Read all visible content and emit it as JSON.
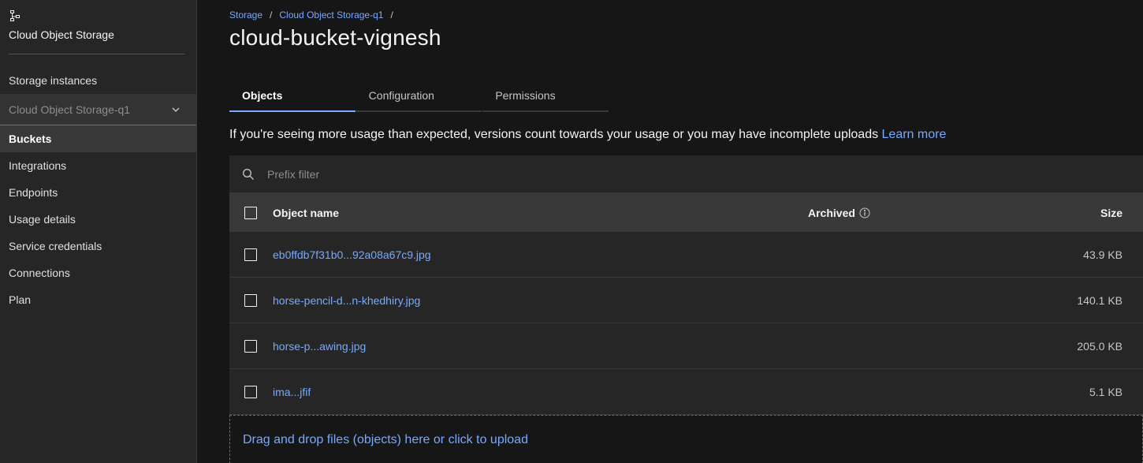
{
  "sidebar": {
    "service_title": "Cloud Object Storage",
    "items": [
      {
        "label": "Storage instances"
      },
      {
        "label": "Cloud Object Storage-q1"
      },
      {
        "label": "Buckets"
      },
      {
        "label": "Integrations"
      },
      {
        "label": "Endpoints"
      },
      {
        "label": "Usage details"
      },
      {
        "label": "Service credentials"
      },
      {
        "label": "Connections"
      },
      {
        "label": "Plan"
      }
    ]
  },
  "breadcrumb": {
    "items": [
      "Storage",
      "Cloud Object Storage-q1"
    ],
    "separator": "/"
  },
  "page": {
    "title": "cloud-bucket-vignesh"
  },
  "tabs": [
    {
      "label": "Objects",
      "active": true
    },
    {
      "label": "Configuration",
      "active": false
    },
    {
      "label": "Permissions",
      "active": false
    }
  ],
  "notice": {
    "text": "If you're seeing more usage than expected, versions count towards your usage or you may have incomplete uploads ",
    "link": "Learn more"
  },
  "filter": {
    "placeholder": "Prefix filter"
  },
  "table": {
    "headers": {
      "name": "Object name",
      "archived": "Archived",
      "size": "Size"
    },
    "rows": [
      {
        "name": "eb0ffdb7f31b0...92a08a67c9.jpg",
        "size": "43.9 KB"
      },
      {
        "name": "horse-pencil-d...n-khedhiry.jpg",
        "size": "140.1 KB"
      },
      {
        "name": "horse-p...awing.jpg",
        "size": "205.0 KB"
      },
      {
        "name": "ima...jfif",
        "size": "5.1 KB"
      }
    ]
  },
  "upload": {
    "text": "Drag and drop files (objects) here or click to upload"
  },
  "colors": {
    "accent": "#78a9ff",
    "background": "#161616",
    "sidebar": "#262626"
  }
}
